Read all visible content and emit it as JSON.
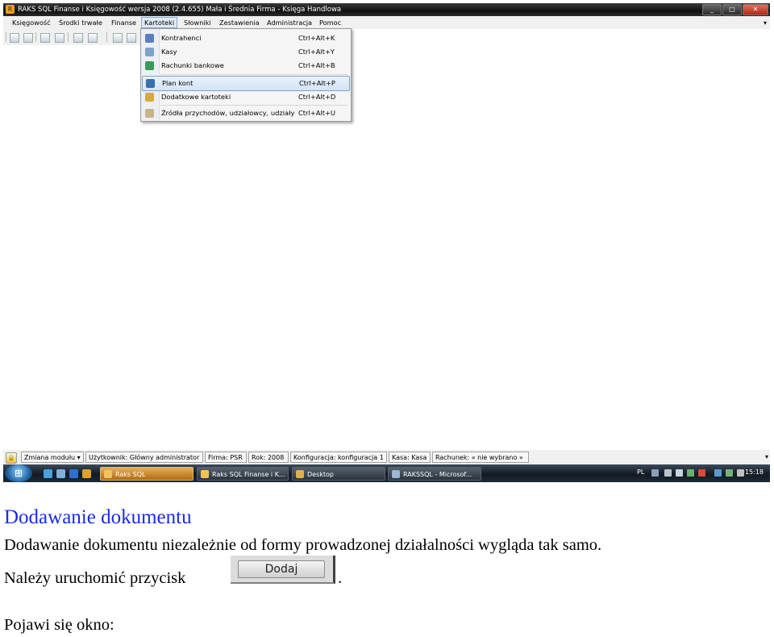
{
  "window": {
    "title": "RAKS SQL Finanse i Księgowość wersja 2008 (2.4.655) Mała i Średnia Firma - Księga Handlowa",
    "controls": [
      "_",
      "□",
      "✕"
    ]
  },
  "menu": {
    "items": [
      "Księgowość",
      "Środki trwałe",
      "Finanse",
      "Kartoteki",
      "Słowniki",
      "Zestawienia",
      "Administracja",
      "Pomoc"
    ],
    "active": "Kartoteki"
  },
  "dropdown": {
    "items": [
      {
        "label": "Kontrahenci",
        "shortcut": "Ctrl+Alt+K",
        "icon": "contacts-icon",
        "color": "#5a7fc0"
      },
      {
        "label": "Kasy",
        "shortcut": "Ctrl+Alt+Y",
        "icon": "cashbox-icon",
        "color": "#7fa3c8"
      },
      {
        "label": "Rachunki bankowe",
        "shortcut": "Ctrl+Alt+B",
        "icon": "bank-icon",
        "color": "#3a9a5a"
      },
      {
        "label": "Plan kont",
        "shortcut": "Ctrl+Alt+P",
        "icon": "chart-of-accounts-icon",
        "color": "#3a6fb0",
        "highlighted": true
      },
      {
        "label": "Dodatkowe kartoteki",
        "shortcut": "Ctrl+Alt+D",
        "icon": "folder-icon",
        "color": "#d9a93a"
      },
      {
        "label": "Źródła przychodów, udziałowcy, udziały",
        "shortcut": "Ctrl+Alt+U",
        "icon": "income-sources-icon",
        "color": "#c9b48a"
      }
    ]
  },
  "statusbar": {
    "module": "Zmiana modułu",
    "user": "Użytkownik: Główny administrator",
    "company": "Firma: PSR",
    "year": "Rok: 2008",
    "config": "Konfiguracja: konfiguracja 1",
    "cash": "Kasa: Kasa",
    "account": "Rachunek: « nie wybrano »"
  },
  "taskbar": {
    "tasks": [
      {
        "label": "Raks SQL",
        "active": true
      },
      {
        "label": "Raks SQL Finanse i K...",
        "active": false
      },
      {
        "label": "Desktop",
        "active": false
      },
      {
        "label": "RAKSSQL - Microsof...",
        "active": false
      }
    ],
    "lang": "PL",
    "time": "15:18"
  },
  "doc": {
    "heading": "Dodawanie dokumentu",
    "para1": "Dodawanie dokumentu niezależnie od formy prowadzonej działalności wygląda tak samo.",
    "para2_prefix": "Należy uruchomić przycisk",
    "button_label": "Dodaj",
    "para2_suffix": ".",
    "para3": "Pojawi się okno:"
  },
  "colors": {
    "heading": "#1a2ae6",
    "highlight": "#d3e4f6",
    "taskbar_active": "#d08a2a"
  }
}
